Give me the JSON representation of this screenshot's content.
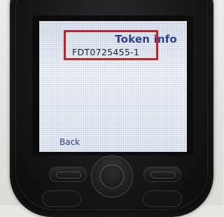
{
  "screen": {
    "title": "Token info",
    "token_id": "FDT0725455-1",
    "left_softkey": "Back"
  },
  "highlight": {
    "color": "#e0161e"
  },
  "colors": {
    "title_text": "#2f3f8f",
    "body_text": "#1e2430",
    "device_body": "#151516",
    "screen_bg": "#e9eef6"
  },
  "icons": {
    "nav_pad": "navigation-ring-icon",
    "left_softkey_button": "softkey-left-icon",
    "right_softkey_button": "softkey-right-icon"
  }
}
